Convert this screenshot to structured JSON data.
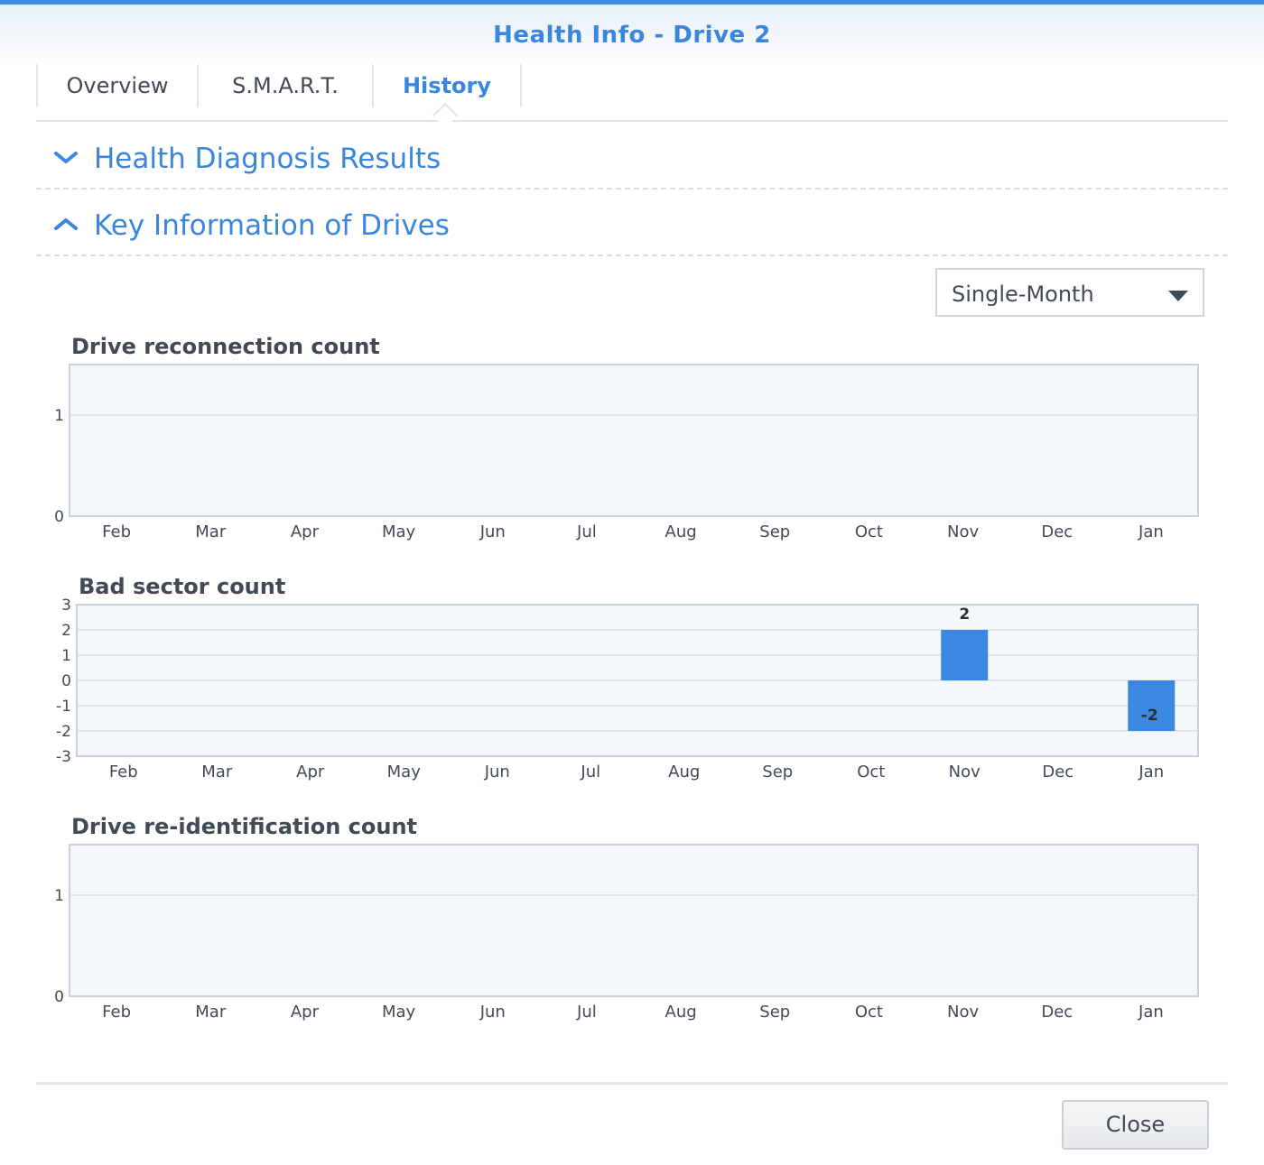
{
  "window": {
    "title": "Health Info - Drive 2"
  },
  "tabs": [
    {
      "label": "Overview",
      "active": false
    },
    {
      "label": "S.M.A.R.T.",
      "active": false
    },
    {
      "label": "History",
      "active": true
    }
  ],
  "sections": {
    "diagnosis": {
      "label": "Health Diagnosis Results",
      "expanded": false
    },
    "key_info": {
      "label": "Key Information of Drives",
      "expanded": true
    }
  },
  "period_select": {
    "value": "Single-Month"
  },
  "colors": {
    "accent": "#3a86dc",
    "bar": "#3b88e0",
    "plot_bg": "#f4f8fd",
    "grid": "#e1e6ec"
  },
  "icons": {
    "collapsed": "chevron-down-icon",
    "expanded": "chevron-up-icon",
    "dropdown": "caret-down-icon"
  },
  "footer": {
    "close_label": "Close"
  },
  "chart_data": [
    {
      "type": "bar",
      "title": "Drive reconnection count",
      "categories": [
        "Feb",
        "Mar",
        "Apr",
        "May",
        "Jun",
        "Jul",
        "Aug",
        "Sep",
        "Oct",
        "Nov",
        "Dec",
        "Jan"
      ],
      "values": [
        0,
        0,
        0,
        0,
        0,
        0,
        0,
        0,
        0,
        0,
        0,
        0
      ],
      "ylim": [
        0,
        1.5
      ],
      "yticks": [
        0,
        1
      ],
      "grid": true
    },
    {
      "type": "bar",
      "title": "Bad sector count",
      "categories": [
        "Feb",
        "Mar",
        "Apr",
        "May",
        "Jun",
        "Jul",
        "Aug",
        "Sep",
        "Oct",
        "Nov",
        "Dec",
        "Jan"
      ],
      "values": [
        0,
        0,
        0,
        0,
        0,
        0,
        0,
        0,
        0,
        2,
        0,
        -2
      ],
      "data_labels": [
        "",
        "",
        "",
        "",
        "",
        "",
        "",
        "",
        "",
        "2",
        "",
        "-2"
      ],
      "ylim": [
        -3,
        3
      ],
      "yticks": [
        -3,
        -2,
        -1,
        0,
        1,
        2,
        3
      ],
      "grid": true
    },
    {
      "type": "bar",
      "title": "Drive re-identification count",
      "categories": [
        "Feb",
        "Mar",
        "Apr",
        "May",
        "Jun",
        "Jul",
        "Aug",
        "Sep",
        "Oct",
        "Nov",
        "Dec",
        "Jan"
      ],
      "values": [
        0,
        0,
        0,
        0,
        0,
        0,
        0,
        0,
        0,
        0,
        0,
        0
      ],
      "ylim": [
        0,
        1.5
      ],
      "yticks": [
        0,
        1
      ],
      "grid": true
    }
  ]
}
